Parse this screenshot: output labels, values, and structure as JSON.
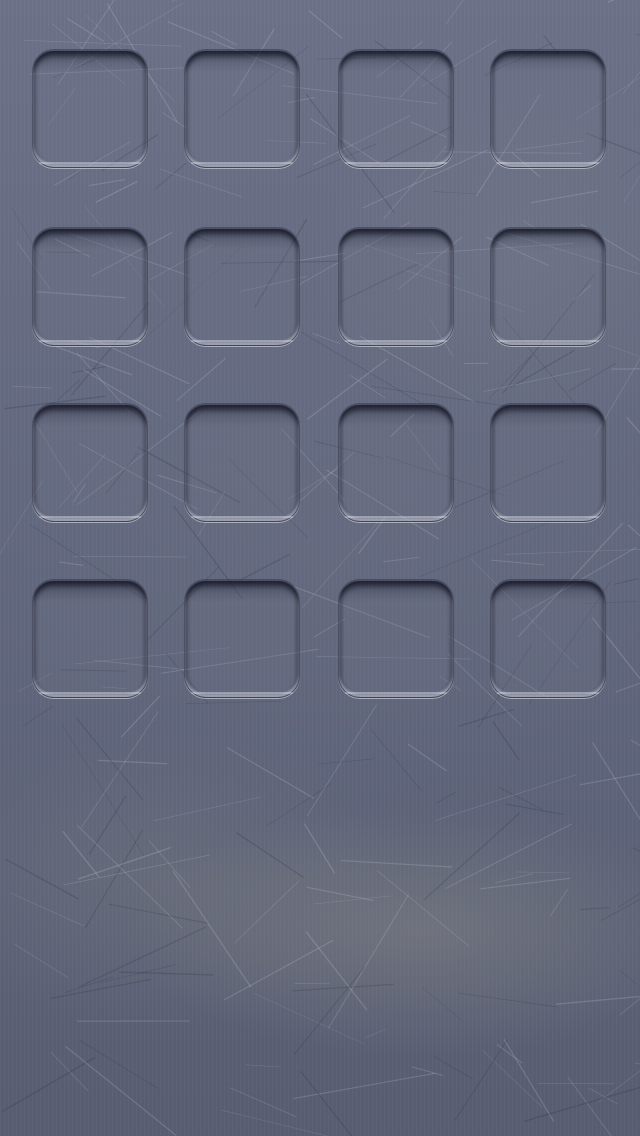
{
  "screen": {
    "name": "home-screen-wallpaper",
    "rows": 4,
    "columns": 4,
    "style": "brushed-metal icon shelves",
    "colors": {
      "metal_base": "#646a80",
      "metal_dark": "#585d72",
      "highlight": "#e6e8f0"
    }
  }
}
